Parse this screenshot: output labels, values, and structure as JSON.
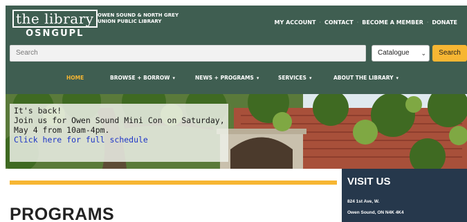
{
  "header": {
    "logo_title": "the library",
    "logo_sub": "OSNGUPL",
    "org_name": "OWEN SOUND & NORTH GREY UNION PUBLIC LIBRARY",
    "utility_links": [
      "MY ACCOUNT",
      "CONTACT",
      "BECOME A MEMBER",
      "DONATE"
    ],
    "separator": "·"
  },
  "search": {
    "placeholder": "Search",
    "scope_selected": "Catalogue",
    "button_label": "Search"
  },
  "nav": {
    "items": [
      {
        "label": "HOME",
        "active": true,
        "dropdown": false
      },
      {
        "label": "BROWSE + BORROW",
        "active": false,
        "dropdown": true
      },
      {
        "label": "NEWS + PROGRAMS",
        "active": false,
        "dropdown": true
      },
      {
        "label": "SERVICES",
        "active": false,
        "dropdown": true
      },
      {
        "label": "ABOUT THE LIBRARY",
        "active": false,
        "dropdown": true
      }
    ],
    "caret": "▾"
  },
  "hero": {
    "line1": "It's back!",
    "line2": "Join us for Owen Sound Mini Con on Saturday,",
    "line3": "May 4 from 10am-4pm.",
    "link_text": "Click here for full schedule"
  },
  "main": {
    "section_title": "PROGRAMS"
  },
  "visit": {
    "title": "VISIT US",
    "address_line1": "824 1st Ave, W.",
    "address_line2": "Owen Sound, ON N4K 4K4"
  },
  "colors": {
    "header_green": "#3f5e51",
    "accent_yellow": "#f7b633",
    "panel_navy": "#26384c",
    "link_blue": "#1d34c7"
  }
}
